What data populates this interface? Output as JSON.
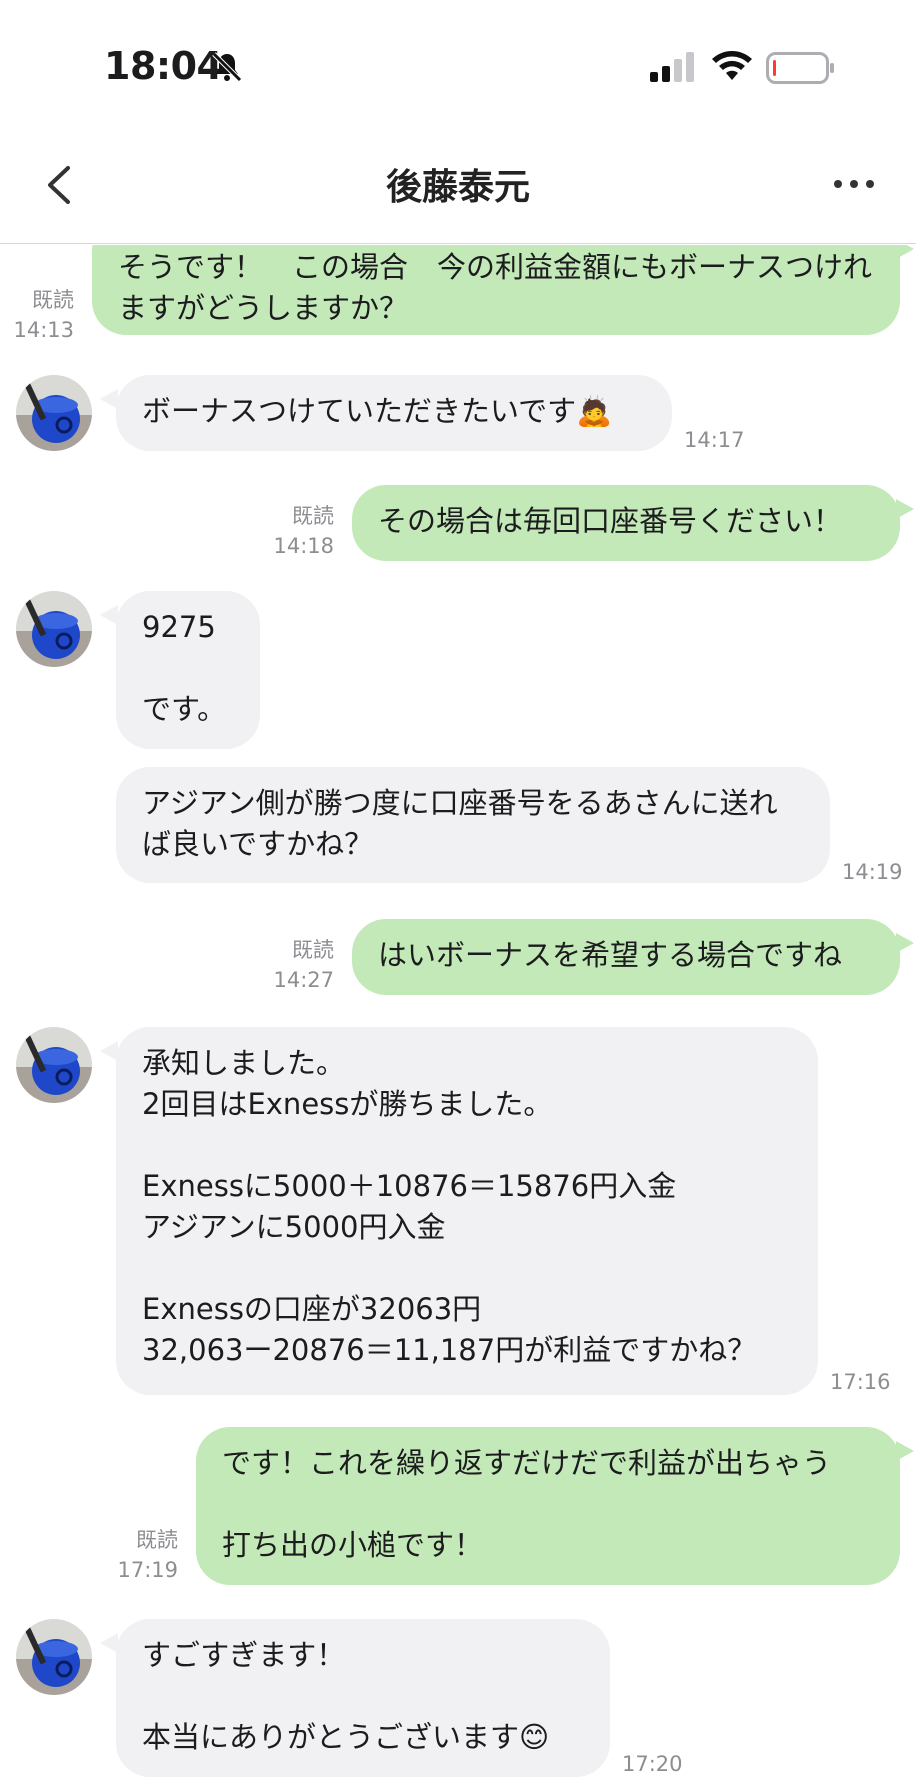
{
  "status": {
    "time": "18:04"
  },
  "header": {
    "title": "後藤泰元"
  },
  "messages": [
    {
      "text": "そうです！　この場合　今の利益金額にもボーナスつけれますがどうしますか？",
      "read": "既読",
      "time": "14:13"
    },
    {
      "text": "ボーナスつけていただきたいです🙇",
      "time": "14:17"
    },
    {
      "text": "その場合は毎回口座番号ください！",
      "read": "既読",
      "time": "14:18"
    },
    {
      "text": "9275\n\nです。"
    },
    {
      "text": "アジアン側が勝つ度に口座番号をるあさんに送れば良いですかね？",
      "time": "14:19"
    },
    {
      "text": "はいボーナスを希望する場合ですね",
      "read": "既読",
      "time": "14:27"
    },
    {
      "text": "承知しました。\n2回目はExnessが勝ちました。\n\nExnessに5000＋10876＝15876円入金\nアジアンに5000円入金\n\nExnessの口座が32063円\n32,063ー20876＝11,187円が利益ですかね？",
      "time": "17:16"
    },
    {
      "text": "です！これを繰り返すだけだで利益が出ちゃう\n\n打ち出の小槌です！",
      "read": "既読",
      "time": "17:19"
    },
    {
      "text": "すごすぎます！\n\n本当にありがとうございます😊",
      "time": "17:20"
    }
  ]
}
